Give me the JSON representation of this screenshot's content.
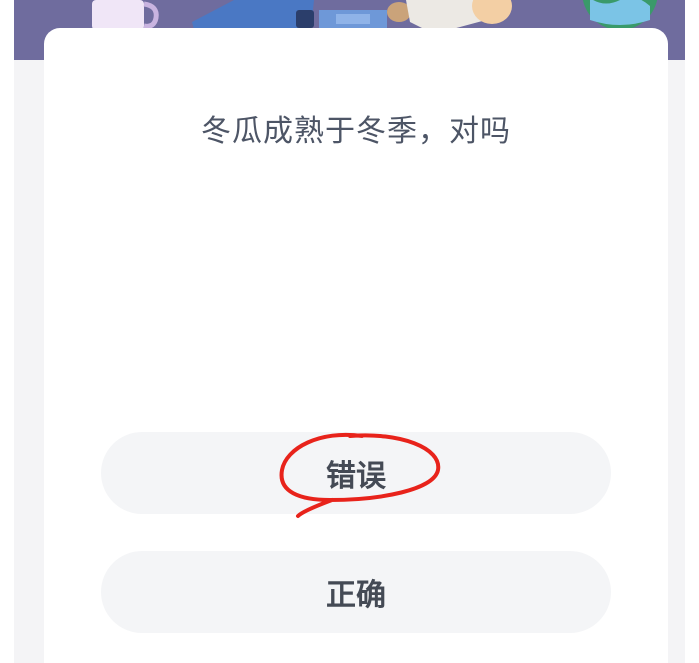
{
  "quiz": {
    "question": "冬瓜成熟于冬季，对吗",
    "options": [
      {
        "label": "错误"
      },
      {
        "label": "正确"
      }
    ]
  },
  "colors": {
    "banner": "#6f6c9e",
    "card_bg": "#ffffff",
    "option_bg": "#f4f5f7",
    "question_text": "#4d5566",
    "annotation_stroke": "#e8231b"
  },
  "icons": {
    "banner_illustration": "study-desk-illustration",
    "annotation": "hand-drawn-circle"
  }
}
